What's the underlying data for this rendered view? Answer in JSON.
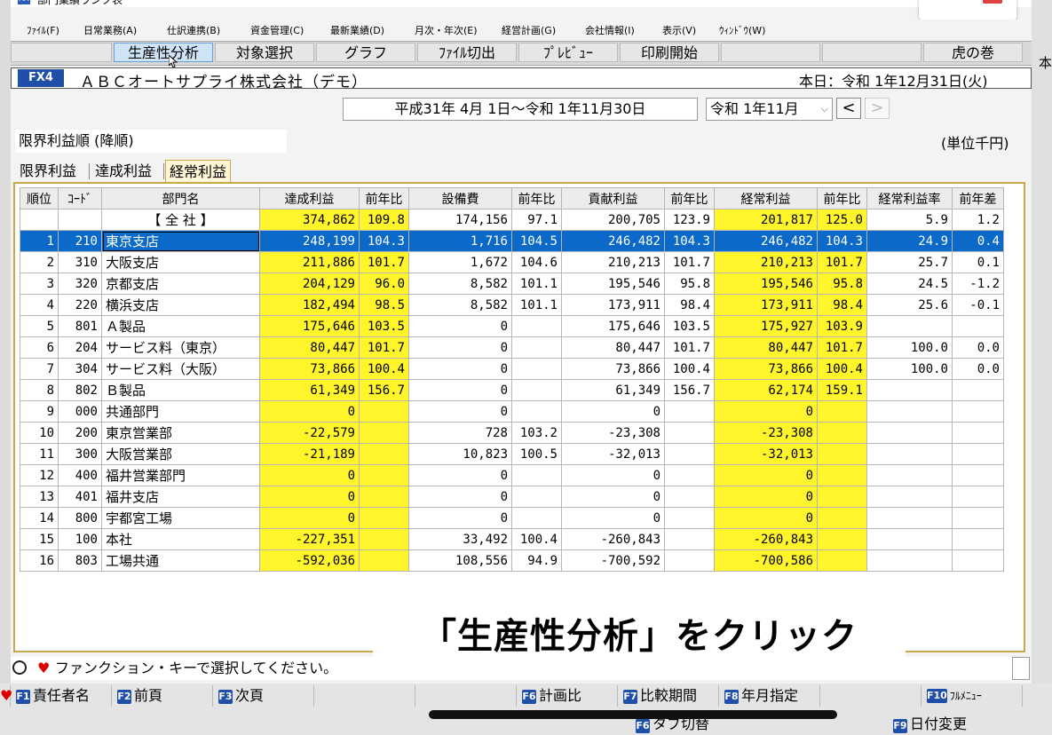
{
  "window": {
    "title": "部門業績ランク表",
    "app_icon_label": "AA"
  },
  "menu": [
    "ﾌｧｲﾙ(F)",
    "日常業務(A)",
    "仕訳連携(B)",
    "資金管理(C)",
    "最新業績(D)",
    "月次・年次(E)",
    "経営計画(G)",
    "会社情報(I)",
    "表示(V)",
    "ｳｨﾝﾄﾞｳ(W)"
  ],
  "toolbar": {
    "buttons": [
      "生産性分析",
      "対象選択",
      "グラフ",
      "ﾌｧｲﾙ切出",
      "ﾌﾟﾚﾋﾞｭｰ",
      "印刷開始"
    ],
    "right": "虎の巻"
  },
  "right_edge_char": "本",
  "company": {
    "code": "FX4",
    "name": "ＡＢＣオートサプライ株式会社（デモ）",
    "today": "本日：令和 1年12月31日(火)"
  },
  "period": {
    "range": "平成31年 4月 1日～令和 1年11月30日",
    "month_select": "令和 1年11月",
    "prev": "<",
    "next": ">"
  },
  "sort_order": "限界利益順 (降順)",
  "unit": "(単位千円)",
  "tabs": [
    "限界利益",
    "達成利益",
    "経常利益"
  ],
  "active_tab": 2,
  "table": {
    "headers": [
      "順位",
      "ｺｰﾄﾞ",
      "部門名",
      "達成利益",
      "前年比",
      "設備費",
      "前年比",
      "貢献利益",
      "前年比",
      "経常利益",
      "前年比",
      "経常利益率",
      "前年差"
    ],
    "total": {
      "name": "【 全 社 】",
      "cells": [
        "374,862",
        "109.8",
        "174,156",
        "97.1",
        "200,705",
        "123.9",
        "201,817",
        "125.0",
        "5.9",
        "1.2"
      ]
    },
    "rows": [
      {
        "rank": "1",
        "code": "210",
        "name": "東京支店",
        "cells": [
          "248,199",
          "104.3",
          "1,716",
          "104.5",
          "246,482",
          "104.3",
          "246,482",
          "104.3",
          "24.9",
          "0.4"
        ],
        "selected": true
      },
      {
        "rank": "2",
        "code": "310",
        "name": "大阪支店",
        "cells": [
          "211,886",
          "101.7",
          "1,672",
          "104.6",
          "210,213",
          "101.7",
          "210,213",
          "101.7",
          "25.7",
          "0.1"
        ]
      },
      {
        "rank": "3",
        "code": "320",
        "name": "京都支店",
        "cells": [
          "204,129",
          "96.0",
          "8,582",
          "101.1",
          "195,546",
          "95.8",
          "195,546",
          "95.8",
          "24.5",
          "-1.2"
        ]
      },
      {
        "rank": "4",
        "code": "220",
        "name": "横浜支店",
        "cells": [
          "182,494",
          "98.5",
          "8,582",
          "101.1",
          "173,911",
          "98.4",
          "173,911",
          "98.4",
          "25.6",
          "-0.1"
        ]
      },
      {
        "rank": "5",
        "code": "801",
        "name": "Ａ製品",
        "cells": [
          "175,646",
          "103.5",
          "0",
          "",
          "175,646",
          "103.5",
          "175,927",
          "103.9",
          "",
          ""
        ]
      },
      {
        "rank": "6",
        "code": "204",
        "name": "サービス料（東京）",
        "cells": [
          "80,447",
          "101.7",
          "0",
          "",
          "80,447",
          "101.7",
          "80,447",
          "101.7",
          "100.0",
          "0.0"
        ]
      },
      {
        "rank": "7",
        "code": "304",
        "name": "サービス料（大阪）",
        "cells": [
          "73,866",
          "100.4",
          "0",
          "",
          "73,866",
          "100.4",
          "73,866",
          "100.4",
          "100.0",
          "0.0"
        ]
      },
      {
        "rank": "8",
        "code": "802",
        "name": "Ｂ製品",
        "cells": [
          "61,349",
          "156.7",
          "0",
          "",
          "61,349",
          "156.7",
          "62,174",
          "159.1",
          "",
          ""
        ]
      },
      {
        "rank": "9",
        "code": "000",
        "name": "共通部門",
        "cells": [
          "0",
          "",
          "0",
          "",
          "0",
          "",
          "0",
          "",
          "",
          ""
        ]
      },
      {
        "rank": "10",
        "code": "200",
        "name": "東京営業部",
        "cells": [
          "-22,579",
          "",
          "728",
          "103.2",
          "-23,308",
          "",
          "-23,308",
          "",
          "",
          ""
        ]
      },
      {
        "rank": "11",
        "code": "300",
        "name": "大阪営業部",
        "cells": [
          "-21,189",
          "",
          "10,823",
          "100.5",
          "-32,013",
          "",
          "-32,013",
          "",
          "",
          ""
        ]
      },
      {
        "rank": "12",
        "code": "400",
        "name": "福井営業部門",
        "cells": [
          "0",
          "",
          "0",
          "",
          "0",
          "",
          "0",
          "",
          "",
          ""
        ]
      },
      {
        "rank": "13",
        "code": "401",
        "name": "福井支店",
        "cells": [
          "0",
          "",
          "0",
          "",
          "0",
          "",
          "0",
          "",
          "",
          ""
        ]
      },
      {
        "rank": "14",
        "code": "800",
        "name": "宇都宮工場",
        "cells": [
          "0",
          "",
          "0",
          "",
          "0",
          "",
          "0",
          "",
          "",
          ""
        ]
      },
      {
        "rank": "15",
        "code": "100",
        "name": "本社",
        "cells": [
          "-227,351",
          "",
          "33,492",
          "100.4",
          "-260,843",
          "",
          "-260,843",
          "",
          "",
          ""
        ]
      },
      {
        "rank": "16",
        "code": "803",
        "name": "工場共通",
        "cells": [
          "-592,036",
          "",
          "108,556",
          "94.9",
          "-700,592",
          "",
          "-700,586",
          "",
          "",
          ""
        ]
      }
    ]
  },
  "caption": "「生産性分析」をクリック",
  "status": "ファンクション・キーで選択してください。",
  "fkeys": [
    {
      "key": "F1",
      "label": "責任者名"
    },
    {
      "key": "F2",
      "label": "前頁"
    },
    {
      "key": "F3",
      "label": "次頁"
    },
    {
      "key": "F6",
      "label": "計画比"
    },
    {
      "key": "F7",
      "label": "比較期間"
    },
    {
      "key": "F8",
      "label": "年月指定"
    },
    {
      "key": "F10",
      "label": "ﾌﾙﾒﾆｭｰ"
    }
  ],
  "fkeys2": [
    {
      "key": "F6",
      "label": "タブ切替"
    },
    {
      "key": "F9",
      "label": "日付変更"
    }
  ],
  "colors": {
    "highlight_yellow": "#fff52a",
    "selected_row": "#0b69c9",
    "fkey_blue": "#1f4fa8"
  }
}
